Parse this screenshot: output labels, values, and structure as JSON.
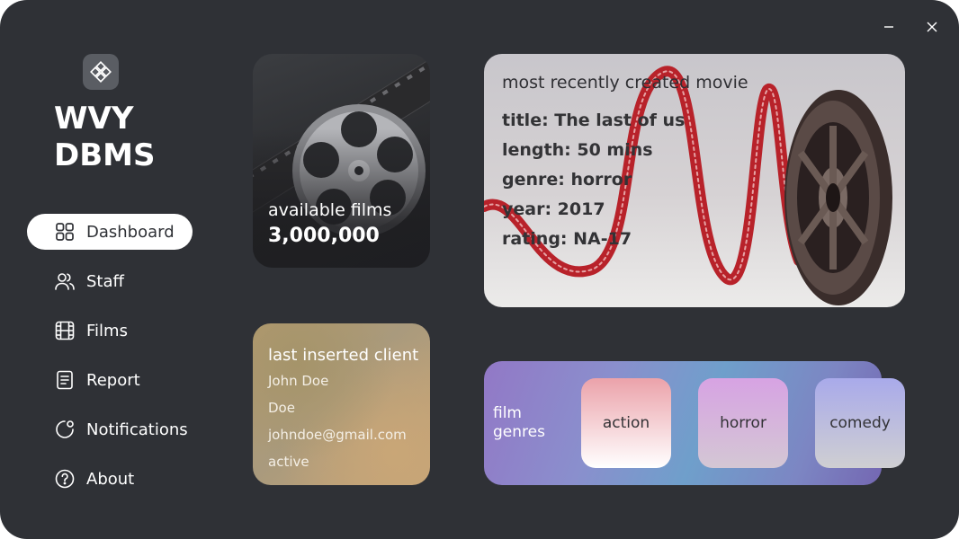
{
  "window": {
    "controls": {
      "minimize_icon": "minimize-icon",
      "close_icon": "close-icon"
    }
  },
  "brand": {
    "logo_icon": "diamond-grid-icon",
    "line1": "WVY",
    "line2": "DBMS"
  },
  "nav": {
    "items": [
      {
        "label": "Dashboard",
        "icon": "grid-icon",
        "active": true
      },
      {
        "label": "Staff",
        "icon": "users-icon",
        "active": false
      },
      {
        "label": "Films",
        "icon": "film-icon",
        "active": false
      },
      {
        "label": "Report",
        "icon": "document-icon",
        "active": false
      },
      {
        "label": "Notifications",
        "icon": "bell-icon",
        "active": false
      },
      {
        "label": "About",
        "icon": "help-icon",
        "active": false
      }
    ]
  },
  "films_card": {
    "label": "available films",
    "value": "3,000,000"
  },
  "recent_movie": {
    "heading": "most recently created movie",
    "lines": [
      "title: The last of us",
      "length: 50 mins",
      "genre: horror",
      "year: 2017",
      "rating: NA-17"
    ]
  },
  "client_card": {
    "title": "last inserted client",
    "lines": [
      "John Doe",
      "Doe",
      "johndoe@gmail.com",
      "active"
    ]
  },
  "genres": {
    "title_line1": "film",
    "title_line2": "genres",
    "items": [
      "action",
      "horror",
      "comedy"
    ]
  },
  "colors": {
    "background": "#2f3136",
    "nav_active_bg": "#ffffff",
    "text_light": "#ffffff",
    "film_strip_red": "#c0262b"
  }
}
